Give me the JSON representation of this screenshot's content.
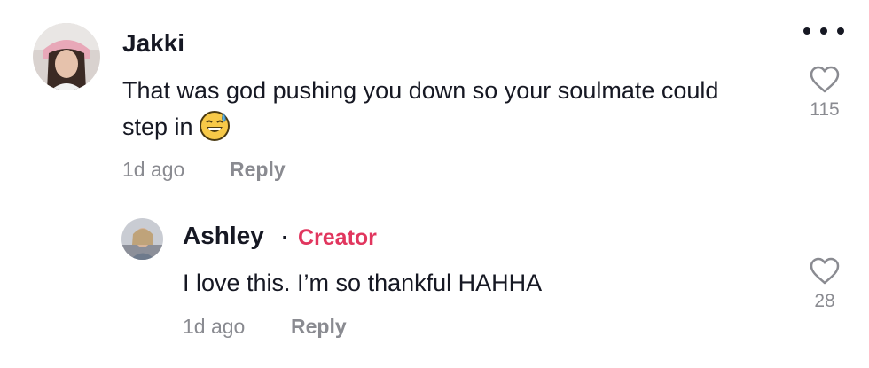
{
  "comments": [
    {
      "username": "Jakki",
      "text": "That was god pushing you down so your soulmate could step in",
      "emoji": "sweat-smile-emoji",
      "timestamp": "1d ago",
      "reply_label": "Reply",
      "likes": "115"
    }
  ],
  "replies": [
    {
      "username": "Ashley",
      "separator": "·",
      "badge": "Creator",
      "text": "I love this. I’m so thankful HAHHA",
      "timestamp": "1d ago",
      "reply_label": "Reply",
      "likes": "28"
    }
  ],
  "icons": {
    "more": "more-icon",
    "like": "heart-icon"
  },
  "colors": {
    "creator_badge": "#e1365e",
    "meta_text": "#8a8b91",
    "primary_text": "#161823"
  }
}
